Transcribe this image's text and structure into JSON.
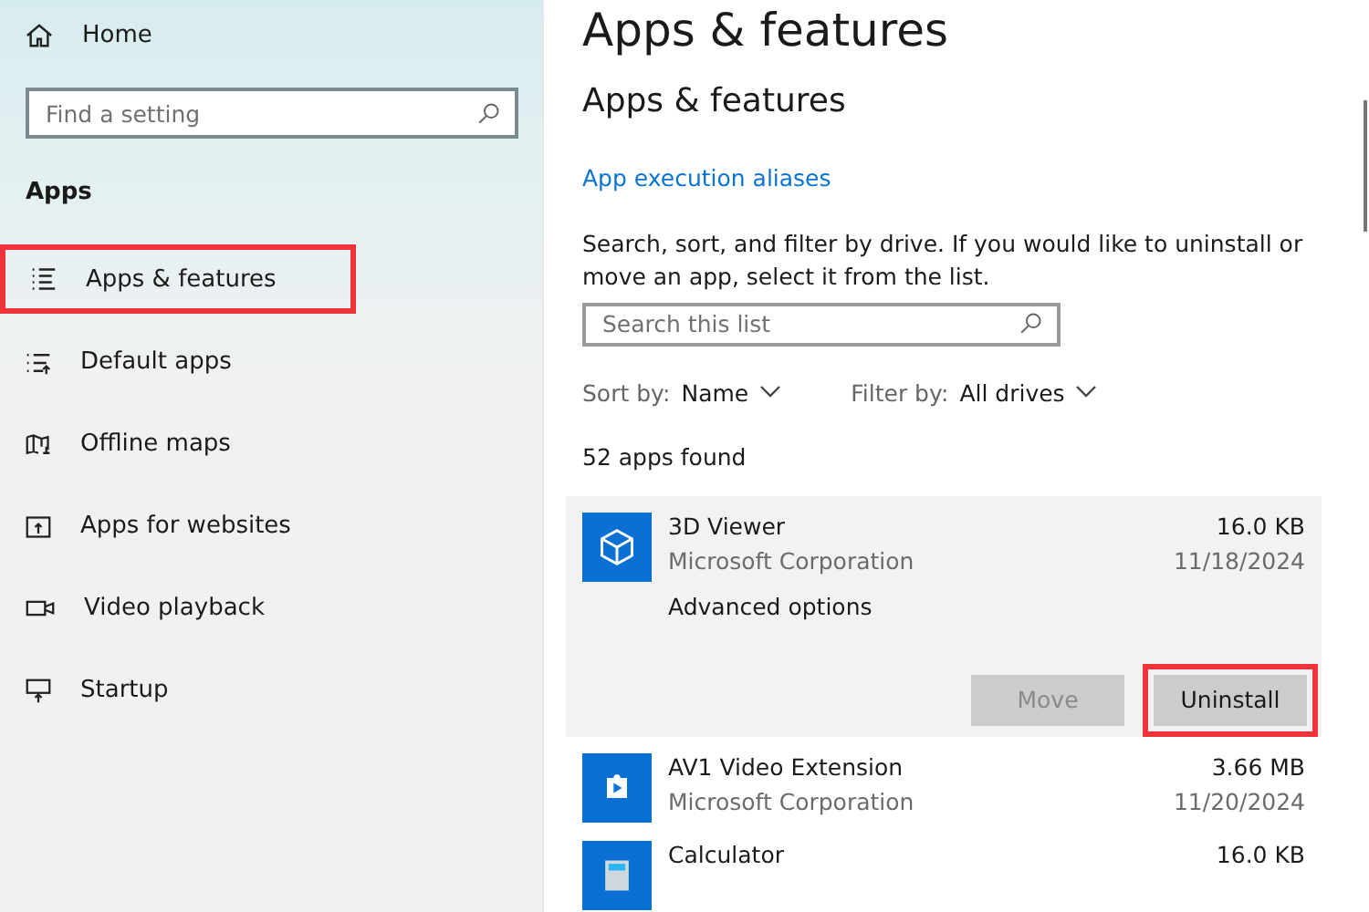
{
  "sidebar": {
    "home": "Home",
    "search": {
      "placeholder": "Find a setting"
    },
    "section": "Apps",
    "items": [
      {
        "label": "Apps & features",
        "highlighted": true
      },
      {
        "label": "Default apps",
        "highlighted": false
      },
      {
        "label": "Offline maps",
        "highlighted": false
      },
      {
        "label": "Apps for websites",
        "highlighted": false
      },
      {
        "label": "Video playback",
        "highlighted": false
      },
      {
        "label": "Startup",
        "highlighted": false
      }
    ]
  },
  "main": {
    "page_title": "Apps & features",
    "section_title": "Apps & features",
    "link": "App execution aliases",
    "description": "Search, sort, and filter by drive. If you would like to uninstall or move an app, select it from the list.",
    "search": {
      "placeholder": "Search this list"
    },
    "sort": {
      "label": "Sort by:",
      "value": "Name"
    },
    "filter": {
      "label": "Filter by:",
      "value": "All drives"
    },
    "count": "52 apps found",
    "apps": [
      {
        "name": "3D Viewer",
        "publisher": "Microsoft Corporation",
        "size": "16.0 KB",
        "date": "11/18/2024",
        "expanded": true,
        "options": "Advanced options",
        "buttons": [
          {
            "label": "Move",
            "disabled": true,
            "highlighted": false
          },
          {
            "label": "Uninstall",
            "disabled": false,
            "highlighted": true
          }
        ]
      },
      {
        "name": "AV1 Video Extension",
        "publisher": "Microsoft Corporation",
        "size": "3.66 MB",
        "date": "11/20/2024",
        "expanded": false
      },
      {
        "name": "Calculator",
        "size": "16.0 KB",
        "expanded": false
      }
    ]
  }
}
